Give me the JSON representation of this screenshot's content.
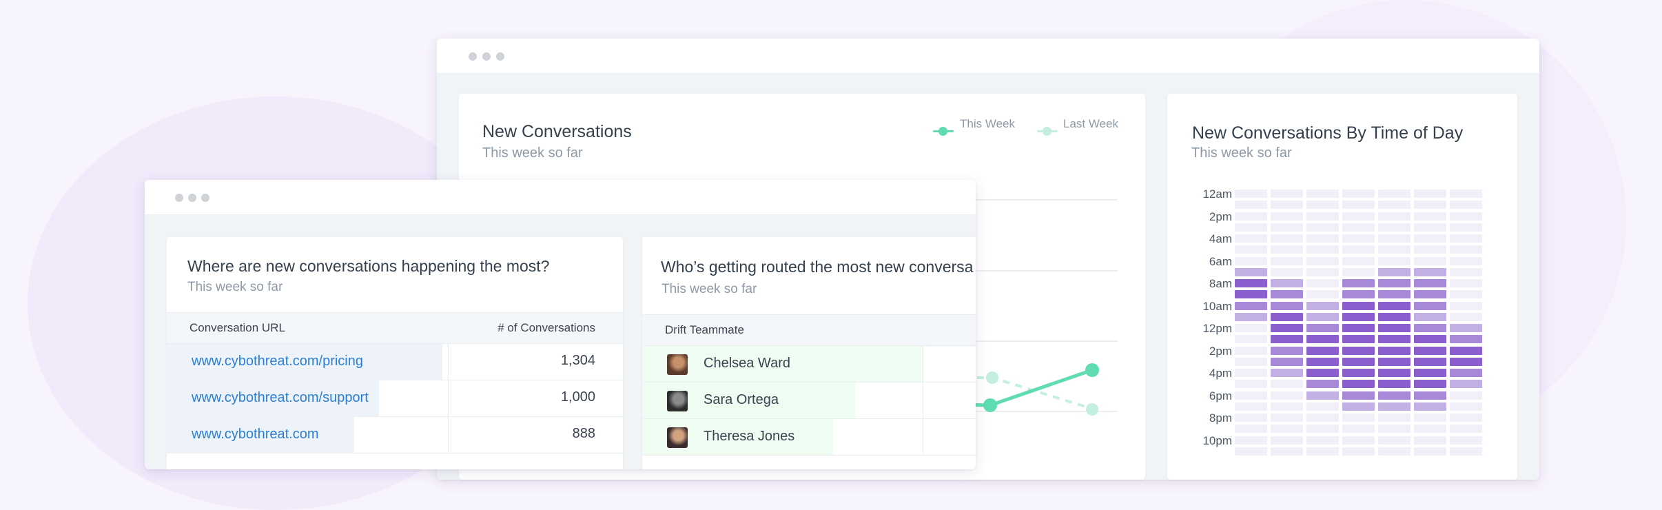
{
  "colors": {
    "this_week": "#5fdcb0",
    "last_week": "#c3eee0",
    "link": "#2a7fd4",
    "heatmap_levels": [
      "#f2eff8",
      "#c2b0e4",
      "#a888d8",
      "#8a5fcd"
    ]
  },
  "back_window": {
    "new_conversations": {
      "title": "New Conversations",
      "subtitle": "This week so far",
      "legend": {
        "this_week": "This Week",
        "last_week": "Last Week"
      }
    },
    "time_of_day": {
      "title": "New Conversations By Time of Day",
      "subtitle": "This week so far",
      "row_labels": [
        "12am",
        "2pm",
        "4am",
        "6am",
        "8am",
        "10am",
        "12pm",
        "2pm",
        "4pm",
        "6pm",
        "8pm",
        "10pm"
      ],
      "levels": [
        [
          0,
          0,
          0,
          0,
          0,
          0,
          0
        ],
        [
          0,
          0,
          0,
          0,
          0,
          0,
          0
        ],
        [
          0,
          0,
          0,
          0,
          0,
          0,
          0
        ],
        [
          0,
          0,
          0,
          0,
          0,
          0,
          0
        ],
        [
          0,
          0,
          0,
          0,
          0,
          0,
          0
        ],
        [
          0,
          0,
          0,
          0,
          0,
          0,
          0
        ],
        [
          0,
          0,
          0,
          0,
          0,
          0,
          0
        ],
        [
          1,
          0,
          0,
          0,
          1,
          1,
          0
        ],
        [
          3,
          1,
          0,
          2,
          2,
          2,
          0
        ],
        [
          3,
          2,
          0,
          2,
          2,
          2,
          0
        ],
        [
          2,
          2,
          1,
          3,
          3,
          2,
          0
        ],
        [
          1,
          3,
          1,
          3,
          3,
          1,
          0
        ],
        [
          0,
          3,
          2,
          3,
          3,
          2,
          1
        ],
        [
          0,
          3,
          3,
          3,
          3,
          3,
          2
        ],
        [
          0,
          2,
          3,
          3,
          3,
          3,
          3
        ],
        [
          0,
          2,
          3,
          3,
          3,
          3,
          3
        ],
        [
          0,
          1,
          3,
          3,
          3,
          3,
          2
        ],
        [
          0,
          0,
          2,
          3,
          3,
          3,
          1
        ],
        [
          0,
          0,
          1,
          2,
          2,
          2,
          0
        ],
        [
          0,
          0,
          0,
          1,
          1,
          1,
          0
        ],
        [
          0,
          0,
          0,
          0,
          0,
          0,
          0
        ],
        [
          0,
          0,
          0,
          0,
          0,
          0,
          0
        ],
        [
          0,
          0,
          0,
          0,
          0,
          0,
          0
        ],
        [
          0,
          0,
          0,
          0,
          0,
          0,
          0
        ]
      ]
    }
  },
  "front_window": {
    "urls_card": {
      "title": "Where are new conversations happening the most?",
      "subtitle": "This week so far",
      "col_url": "Conversation URL",
      "col_count": "# of Conversations",
      "rows": [
        {
          "url": "www.cybothreat.com/pricing",
          "count": "1,304",
          "share": 1.0
        },
        {
          "url": "www.cybothreat.com/support",
          "count": "1,000",
          "share": 0.77
        },
        {
          "url": "www.cybothreat.com",
          "count": "888",
          "share": 0.68
        }
      ]
    },
    "routing_card": {
      "title": "Who’s getting routed the most new conversa",
      "subtitle": "This week so far",
      "col_teammate": "Drift Teammate",
      "col_count": "#",
      "rows": [
        {
          "name": "Chelsea Ward",
          "share": 1.0
        },
        {
          "name": "Sara Ortega",
          "share": 0.76
        },
        {
          "name": "Theresa Jones",
          "share": 0.68
        }
      ]
    }
  }
}
